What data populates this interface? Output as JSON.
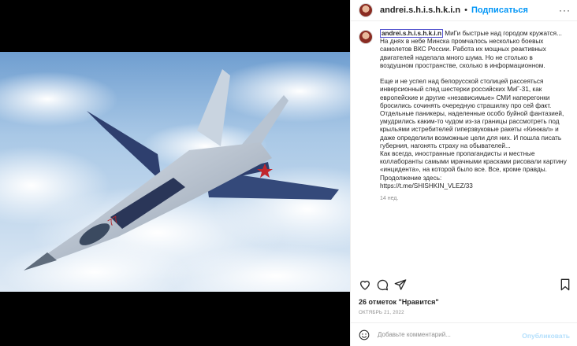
{
  "post": {
    "username": "andrei.s.h.i.s.h.k.i.n",
    "follow_label": "Подписаться",
    "separator": "•",
    "more_label": "···"
  },
  "caption": {
    "username": "andrei.s.h.i.s.h.k.i.n",
    "lines": [
      " МиГи быстрые над городом кружатся...\nНа днях в небе Минска промчалось несколько боевых самолетов ВКС России. Работа их мощных реактивных двигателей наделала много шума. Но не столько в воздушном пространстве, сколько в информационном.\n\nЕще и не успел над белорусской столицей рассеяться инверсионный след шестерки российских МиГ-31, как европейские и другие «независимые» СМИ наперегонки бросились сочинять очередную страшилку про сей факт. Отдельные паникеры, наделенные особо буйной фантазией, умудрились каким-то чудом из-за границы рассмотреть под крыльями истребителей гиперзвуковые ракеты «Кинжал» и даже определили возможные цели для них. И пошла писать губерния, нагонять страху на обывателей...\nКак всегда, иностранные пропагандисты и местные коллаборанты самыми мрачными красками рисовали картину «инцидента», на которой было все. Все, кроме правды. Продолжение здесь:\nhttps://t.me/SHISHKIN_VLEZ/33"
    ],
    "time": "14 нед."
  },
  "engagement": {
    "likes": "26 отметок \"Нравится\"",
    "date": "ОКТЯБРЬ 21, 2022"
  },
  "comment": {
    "placeholder": "Добавьте комментарий...",
    "publish_label": "Опубликовать"
  },
  "icons": {
    "like": "heart-icon",
    "comment": "comment-icon",
    "share": "share-icon",
    "save": "bookmark-icon",
    "emoji": "emoji-icon"
  },
  "colors": {
    "accent": "#0095f6",
    "muted": "#8e8e8e",
    "publish_disabled": "#b3dffc"
  }
}
